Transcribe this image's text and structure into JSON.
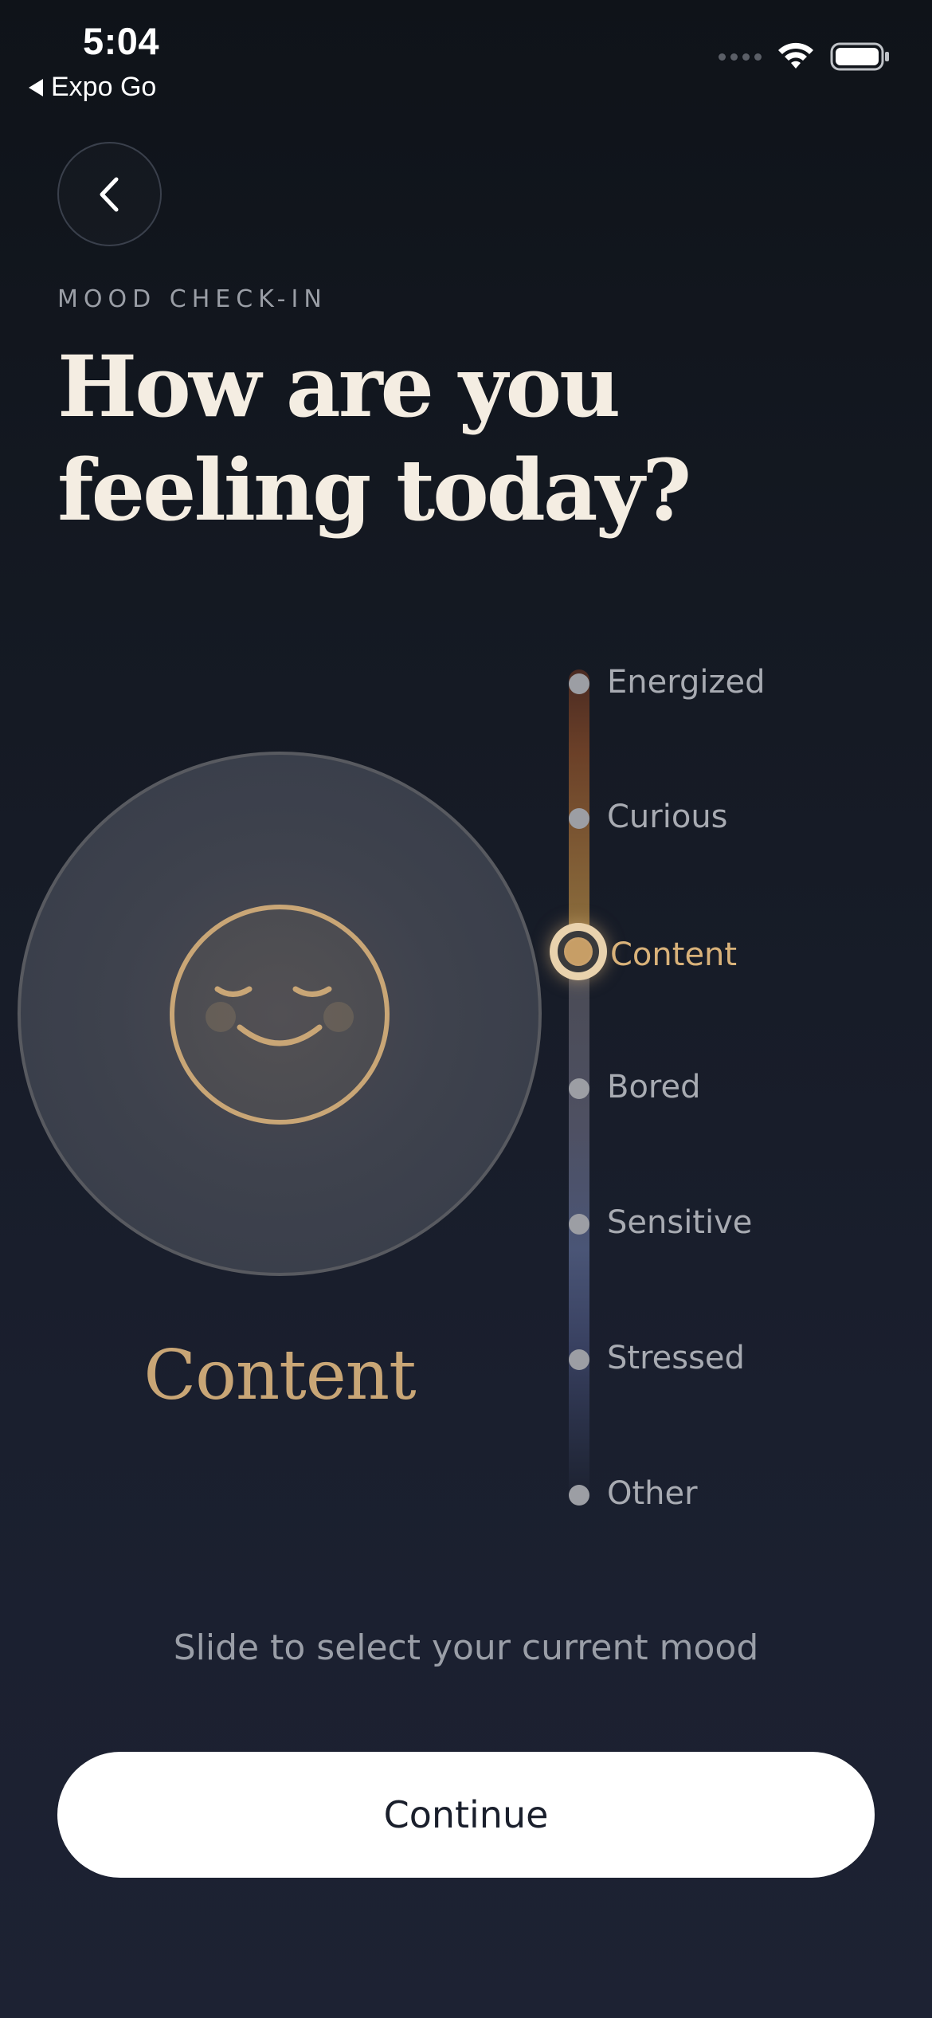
{
  "status_bar": {
    "time": "5:04",
    "back_app": "Expo Go",
    "icons": [
      "cellular-signal-icon",
      "wifi-icon",
      "battery-icon"
    ]
  },
  "header": {
    "back_icon": "chevron-left-icon",
    "eyebrow": "MOOD CHECK-IN",
    "title_line1": "How are you",
    "title_line2": "feeling today?"
  },
  "mood": {
    "selected": "Content",
    "face_icon": "content-face-icon",
    "options": [
      "Energized",
      "Curious",
      "Content",
      "Bored",
      "Sensitive",
      "Stressed",
      "Other"
    ],
    "selected_index": 2
  },
  "hint": "Slide to select your current mood",
  "actions": {
    "continue_label": "Continue"
  },
  "colors": {
    "accent": "#C9A676",
    "active_label": "#D9B27A",
    "title": "#F4EDE2",
    "background_top": "#0F1319",
    "background_bottom": "#1D2233",
    "button_bg": "#FFFFFF"
  }
}
